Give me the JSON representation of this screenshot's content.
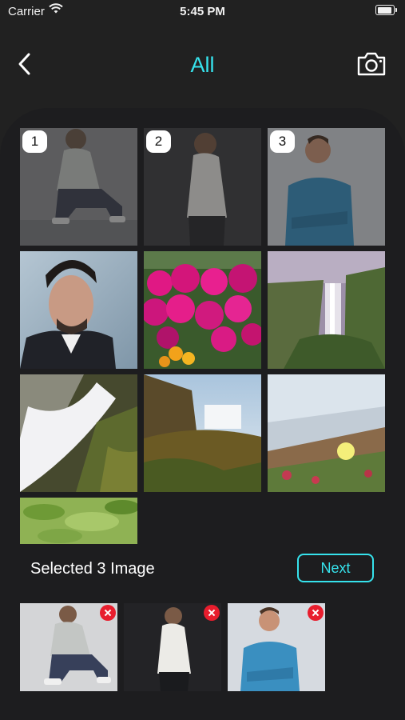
{
  "status_bar": {
    "carrier": "Carrier",
    "time": "5:45 PM"
  },
  "header": {
    "title": "All",
    "back_icon": "chevron-left-icon",
    "camera_icon": "camera-icon"
  },
  "colors": {
    "accent": "#36e2ec",
    "background": "#212121",
    "remove": "#e81d2d"
  },
  "gallery": {
    "photos": [
      {
        "subject": "man crouching",
        "selected": true,
        "order": "1"
      },
      {
        "subject": "man standing white shirt",
        "selected": true,
        "order": "2"
      },
      {
        "subject": "man blue shirt arms crossed",
        "selected": true,
        "order": "3"
      },
      {
        "subject": "man portrait dark jacket",
        "selected": false
      },
      {
        "subject": "pink flowers",
        "selected": false
      },
      {
        "subject": "waterfall cliff",
        "selected": false
      },
      {
        "subject": "waterfall closeup",
        "selected": false
      },
      {
        "subject": "waterfall coast",
        "selected": false
      },
      {
        "subject": "coastal flowers",
        "selected": false
      },
      {
        "subject": "green leaves",
        "selected": false
      }
    ]
  },
  "selection": {
    "label": "Selected 3 Image",
    "next_label": "Next"
  }
}
